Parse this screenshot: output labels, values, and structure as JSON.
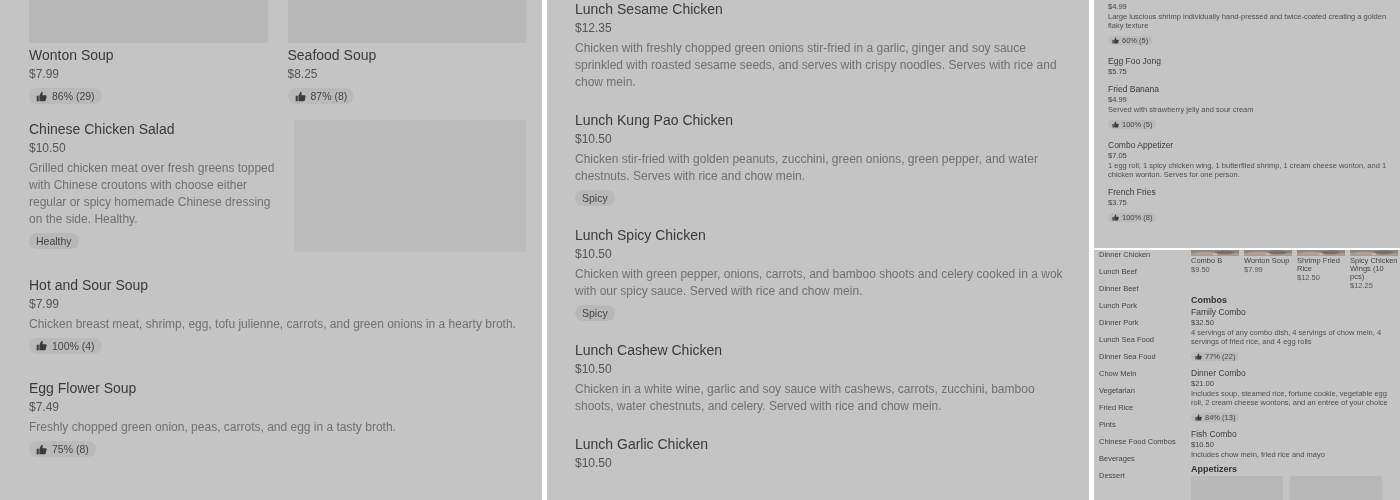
{
  "soups_panel": {
    "cards": [
      {
        "name": "Wonton Soup",
        "price": "$7.99",
        "rating": "86% (29)"
      },
      {
        "name": "Seafood Soup",
        "price": "$8.25",
        "rating": "87% (8)"
      }
    ],
    "items": [
      {
        "name": "Chinese Chicken Salad",
        "price": "$10.50",
        "description": "Grilled chicken meat over fresh greens topped with Chinese croutons with choose either regular or spicy homemade Chinese dressing on the side. Healthy.",
        "tag": "Healthy",
        "has_image": true
      },
      {
        "name": "Hot and Sour Soup",
        "price": "$7.99",
        "description": "Chicken breast meat, shrimp, egg, tofu julienne, carrots, and green onions in a hearty broth.",
        "rating": "100% (4)",
        "has_image": false
      },
      {
        "name": "Egg Flower Soup",
        "price": "$7.49",
        "description": "Freshly chopped green onion, peas, carrots, and egg in a tasty broth.",
        "rating": "75% (8)",
        "has_image": false
      }
    ]
  },
  "lunch_panel": {
    "items": [
      {
        "name": "Lunch Sesame Chicken",
        "price": "$12.35",
        "description": "Chicken with freshly chopped green onions stir-fried in a garlic, ginger and soy sauce sprinkled with roasted sesame seeds, and serves with crispy noodles. Serves with rice and chow mein."
      },
      {
        "name": "Lunch Kung Pao Chicken",
        "price": "$10.50",
        "description": "Chicken stir-fried with golden peanuts, zucchini, green onions, green pepper, and water chestnuts. Serves with rice and chow mein.",
        "tag": "Spicy"
      },
      {
        "name": "Lunch Spicy Chicken",
        "price": "$10.50",
        "description": "Chicken with green pepper, onions, carrots, and bamboo shoots and celery cooked in a wok with our spicy sauce. Served with rice and chow mein.",
        "tag": "Spicy"
      },
      {
        "name": "Lunch Cashew Chicken",
        "price": "$10.50",
        "description": "Chicken in a white wine, garlic and soy sauce with cashews, carrots, zucchini, bamboo shoots, water chestnuts, and celery. Served with rice and chow mein."
      },
      {
        "name": "Lunch Garlic Chicken",
        "price": "$10.50"
      }
    ]
  },
  "appetizers_panel": {
    "items": [
      {
        "price": "$4.99",
        "description": "Large luscious shrimp individually hand-pressed and twice-coated creating a golden flaky texture",
        "rating": "60% (5)"
      },
      {
        "name": "Egg Foo Jong",
        "price": "$5.75"
      },
      {
        "name": "Fried Banana",
        "price": "$4.99",
        "description": "Served with strawberry jelly and sour cream",
        "rating": "100% (5)"
      },
      {
        "name": "Combo Appetizer",
        "price": "$7.05",
        "description": "1 egg roll, 1 spicy chicken wing, 1 butterflied shrimp, 1 cream cheese wonton, and 1 chicken wonton. Serves for one person."
      },
      {
        "name": "French Fries",
        "price": "$3.75",
        "rating": "100% (8)"
      }
    ]
  },
  "category_panel": {
    "sidebar": {
      "items": [
        "Dinner Chicken",
        "Lunch Beef",
        "Dinner Beef",
        "Lunch Pork",
        "Dinner Pork",
        "Lunch Sea Food",
        "Dinner Sea Food",
        "Chow Mein",
        "Vegetarian",
        "Fried Rice",
        "Pints",
        "Chinese Food Combos",
        "Beverages",
        "Dessert"
      ]
    },
    "featured": [
      {
        "name": "Combo B",
        "price": "$9.50"
      },
      {
        "name": "Wonton Soup",
        "price": "$7.99"
      },
      {
        "name": "Shrimp Fried Rice",
        "price": "$12.50"
      },
      {
        "name": "Spicy Chicken Wings (10 pcs)",
        "price": "$12.25"
      }
    ],
    "sections": [
      {
        "title": "Combos",
        "items": [
          {
            "name": "Family Combo",
            "price": "$32.50",
            "description": "4 servings of any combo dish, 4 servings of chow mein, 4 servings of fried rice, and 4 egg rolls",
            "rating": "77% (22)"
          },
          {
            "name": "Dinner Combo",
            "price": "$21.00",
            "description": "Includes soup, steamed rice, fortune cookie, vegetable egg roll, 2 cream cheese wontons, and an entree of your choice",
            "rating": "84% (13)"
          },
          {
            "name": "Fish Combo",
            "price": "$10.50",
            "description": "Includes chow mein, fried rice and mayo"
          }
        ]
      },
      {
        "title": "Appetizers"
      }
    ]
  }
}
